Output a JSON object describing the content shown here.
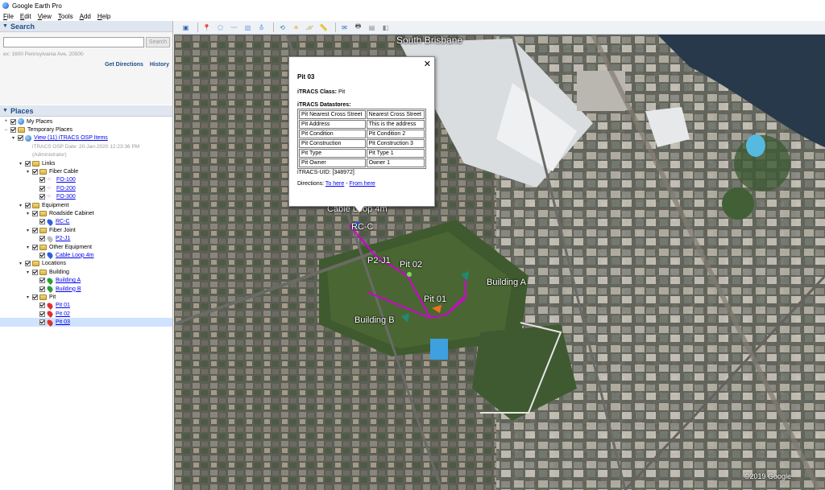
{
  "window": {
    "title": "Google Earth Pro"
  },
  "menu": [
    "File",
    "Edit",
    "View",
    "Tools",
    "Add",
    "Help"
  ],
  "search": {
    "header": "Search",
    "placeholder": "",
    "button": "Search",
    "hint": "ex: 1600 Pennsylvania Ave, 20500",
    "get_directions": "Get Directions",
    "history": "History"
  },
  "places": {
    "header": "Places",
    "tree": [
      {
        "depth": 0,
        "expander": "+",
        "icon": "globe",
        "label": "My Places",
        "link": false,
        "checked": true
      },
      {
        "depth": 0,
        "expander": "−",
        "icon": "folder",
        "label": "Temporary Places",
        "link": false,
        "checked": true
      },
      {
        "depth": 1,
        "expander": "▾",
        "icon": "globe",
        "label": "View (11) iTRACS OSP Items",
        "link": true,
        "checked": true
      },
      {
        "depth": 2,
        "expander": "",
        "icon": "none",
        "label": "iTRACS OSP Date: 20-Jan-2020 12:23:36 PM",
        "link": false,
        "subtle": true,
        "nocheck": true
      },
      {
        "depth": 2,
        "expander": "",
        "icon": "none",
        "label": "(Administrator)",
        "link": false,
        "subtle": true,
        "nocheck": true
      },
      {
        "depth": 2,
        "expander": "▾",
        "icon": "folder",
        "label": "Links",
        "link": false,
        "checked": true
      },
      {
        "depth": 3,
        "expander": "▾",
        "icon": "folder",
        "label": "Fiber Cable",
        "link": false,
        "checked": true
      },
      {
        "depth": 4,
        "expander": "",
        "icon": "path",
        "label": "FO-100",
        "link": true,
        "checked": true
      },
      {
        "depth": 4,
        "expander": "",
        "icon": "path",
        "label": "FO-200",
        "link": true,
        "checked": true
      },
      {
        "depth": 4,
        "expander": "",
        "icon": "path",
        "label": "FO-300",
        "link": true,
        "checked": true
      },
      {
        "depth": 2,
        "expander": "▾",
        "icon": "folder",
        "label": "Equipment",
        "link": false,
        "checked": true
      },
      {
        "depth": 3,
        "expander": "▾",
        "icon": "folder",
        "label": "Roadside Cabinet",
        "link": false,
        "checked": true
      },
      {
        "depth": 4,
        "expander": "",
        "icon": "pin-blue",
        "label": "RC-C",
        "link": true,
        "checked": true
      },
      {
        "depth": 3,
        "expander": "▾",
        "icon": "folder",
        "label": "Fiber Joint",
        "link": false,
        "checked": true
      },
      {
        "depth": 4,
        "expander": "",
        "icon": "pin-grey",
        "label": "P2-J1",
        "link": true,
        "checked": true
      },
      {
        "depth": 3,
        "expander": "▾",
        "icon": "folder",
        "label": "Other Equipment",
        "link": false,
        "checked": true
      },
      {
        "depth": 4,
        "expander": "",
        "icon": "pin-blue",
        "label": "Cable Loop 4m",
        "link": true,
        "checked": true
      },
      {
        "depth": 2,
        "expander": "▾",
        "icon": "folder",
        "label": "Locations",
        "link": false,
        "checked": true
      },
      {
        "depth": 3,
        "expander": "▾",
        "icon": "folder",
        "label": "Building",
        "link": false,
        "checked": true
      },
      {
        "depth": 4,
        "expander": "",
        "icon": "pin-green",
        "label": "Building A",
        "link": true,
        "checked": true
      },
      {
        "depth": 4,
        "expander": "",
        "icon": "pin-green",
        "label": "Building B",
        "link": true,
        "checked": true
      },
      {
        "depth": 3,
        "expander": "▾",
        "icon": "folder",
        "label": "Pit",
        "link": false,
        "checked": true
      },
      {
        "depth": 4,
        "expander": "",
        "icon": "pin-red",
        "label": "Pit 01",
        "link": true,
        "checked": true
      },
      {
        "depth": 4,
        "expander": "",
        "icon": "pin-red",
        "label": "Pit 02",
        "link": true,
        "checked": true
      },
      {
        "depth": 4,
        "expander": "",
        "icon": "pin-red",
        "label": "Pit 03",
        "link": true,
        "checked": true,
        "selected": true
      }
    ]
  },
  "toolbar": {
    "buttons": [
      "sidebar-icon",
      "placemark-icon",
      "polygon-icon",
      "path-icon",
      "overlay-icon",
      "tour-icon",
      "history-icon",
      "sun-icon",
      "planets-icon",
      "ruler-icon",
      "email-icon",
      "print-icon",
      "save-image-icon",
      "maps-icon"
    ]
  },
  "map": {
    "labels": {
      "south_brisbane": "South Brisbane",
      "cable_loop": "Cable Loop 4m",
      "rc_c": "RC-C",
      "p2_j1": "P2-J1",
      "pit_02": "Pit 02",
      "pit_01": "Pit 01",
      "building_a": "Building A",
      "building_b": "Building B"
    },
    "attribution": "©2019 Google"
  },
  "popup": {
    "title": "Pit 03",
    "class_label": "iTRACS Class:",
    "class_value": "Pit",
    "datastores_label": "iTRACS Datastores:",
    "rows": [
      [
        "Pit Nearest Cross Street",
        "Nearest Cross Street"
      ],
      [
        "Pit Address",
        "This is the address"
      ],
      [
        "Pit Condition",
        "Pit Condition 2"
      ],
      [
        "Pit Construction",
        "Pit Construction 3"
      ],
      [
        "Pit Type",
        "Pit Type 1"
      ],
      [
        "Pit Owner",
        "Owner 1"
      ]
    ],
    "uid": "iTRACS-UID: [348972]",
    "directions_label": "Directions:",
    "to_here": "To here",
    "separator": "-",
    "from_here": "From here"
  }
}
